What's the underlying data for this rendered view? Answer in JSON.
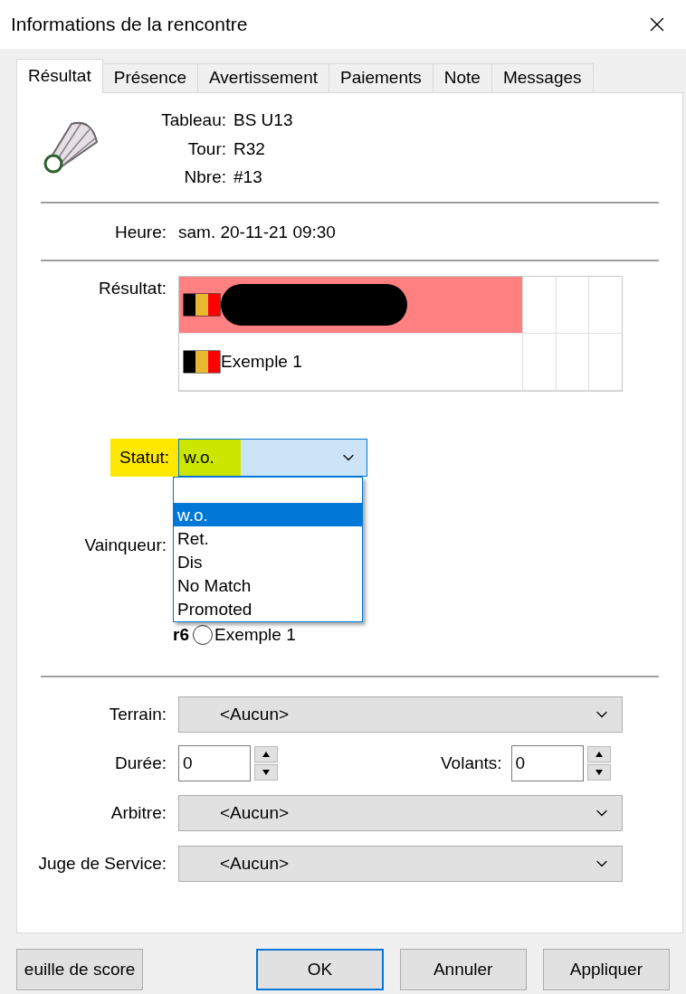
{
  "window": {
    "title": "Informations de la rencontre"
  },
  "tabs": [
    {
      "label": "Résultat",
      "selected": true
    },
    {
      "label": "Présence",
      "selected": false
    },
    {
      "label": "Avertissement",
      "selected": false
    },
    {
      "label": "Paiements",
      "selected": false
    },
    {
      "label": "Note",
      "selected": false
    },
    {
      "label": "Messages",
      "selected": false
    }
  ],
  "match_info": [
    {
      "label": "Tableau:",
      "value": "BS U13"
    },
    {
      "label": "Tour:",
      "value": "R32"
    },
    {
      "label": "Nbre:",
      "value": "#13"
    }
  ],
  "time": {
    "label": "Heure:",
    "value": "sam. 20-11-21 09:30"
  },
  "result": {
    "label": "Résultat:",
    "rows": [
      {
        "kind": "redacted",
        "highlighted": true
      },
      {
        "kind": "name",
        "name": "Exemple 1",
        "highlighted": false
      }
    ]
  },
  "status": {
    "label": "Statut:",
    "highlighted": true,
    "value": "w.o.",
    "expanded": true,
    "options": [
      {
        "kind": "blank",
        "selected": false
      },
      {
        "kind": "text",
        "label": "w.o.",
        "selected": true
      },
      {
        "kind": "text",
        "label": "Ret.",
        "selected": false
      },
      {
        "kind": "text",
        "label": "Dis",
        "selected": false
      },
      {
        "kind": "text",
        "label": "No Match",
        "selected": false
      },
      {
        "kind": "text",
        "label": "Promoted",
        "selected": false
      }
    ]
  },
  "winner": {
    "label": "Vainqueur:",
    "options": [
      {
        "prefix": "r6",
        "label": "Exemple 1",
        "selected": false
      }
    ]
  },
  "court": {
    "label": "Terrain:",
    "value": "<Aucun>"
  },
  "duration": {
    "label": "Durée:",
    "value": "0"
  },
  "shuttles": {
    "label": "Volants:",
    "value": "0"
  },
  "umpire": {
    "label": "Arbitre:",
    "value": "<Aucun>"
  },
  "service_judge": {
    "label": "Juge de Service:",
    "value": "<Aucun>"
  },
  "buttons": [
    {
      "label": "euille de score",
      "default": false
    },
    {
      "label": "OK",
      "default": true
    },
    {
      "label": "Annuler",
      "default": false
    },
    {
      "label": "Appliquer",
      "default": false
    }
  ]
}
